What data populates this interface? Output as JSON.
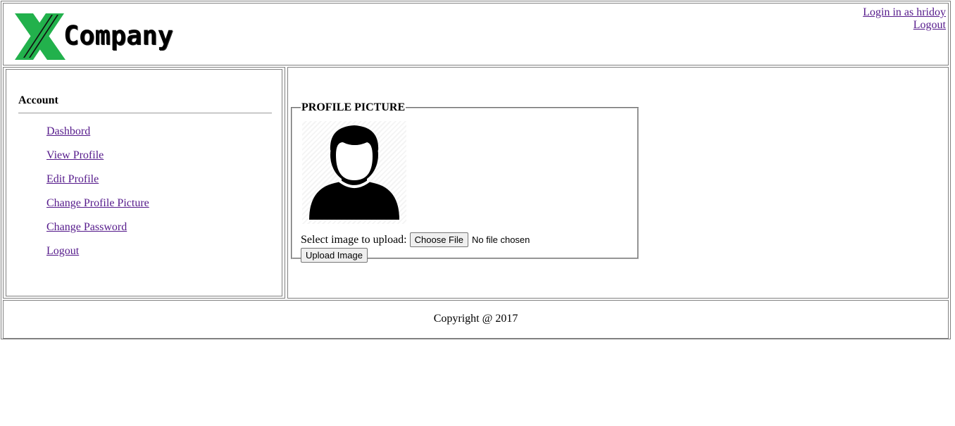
{
  "header": {
    "logo_mark": "X",
    "logo_text": "Company",
    "logged_in_label": "Login in as hridoy",
    "logout_label": "Logout"
  },
  "sidebar": {
    "title": "Account",
    "items": [
      {
        "label": "Dashbord"
      },
      {
        "label": "View Profile"
      },
      {
        "label": "Edit Profile"
      },
      {
        "label": "Change Profile Picture"
      },
      {
        "label": "Change Password"
      },
      {
        "label": "Logout"
      }
    ]
  },
  "main": {
    "fieldset_legend": "PROFILE PICTURE",
    "avatar_icon": "user-silhouette-icon",
    "upload_prompt": "Select image to upload:",
    "choose_file_label": "Choose File",
    "no_file_label": "No file chosen",
    "upload_button_label": "Upload Image"
  },
  "footer": {
    "copyright": "Copyright @ 2017"
  },
  "colors": {
    "logo_green": "#22b14c",
    "link": "#551a8b",
    "border": "#808080"
  }
}
